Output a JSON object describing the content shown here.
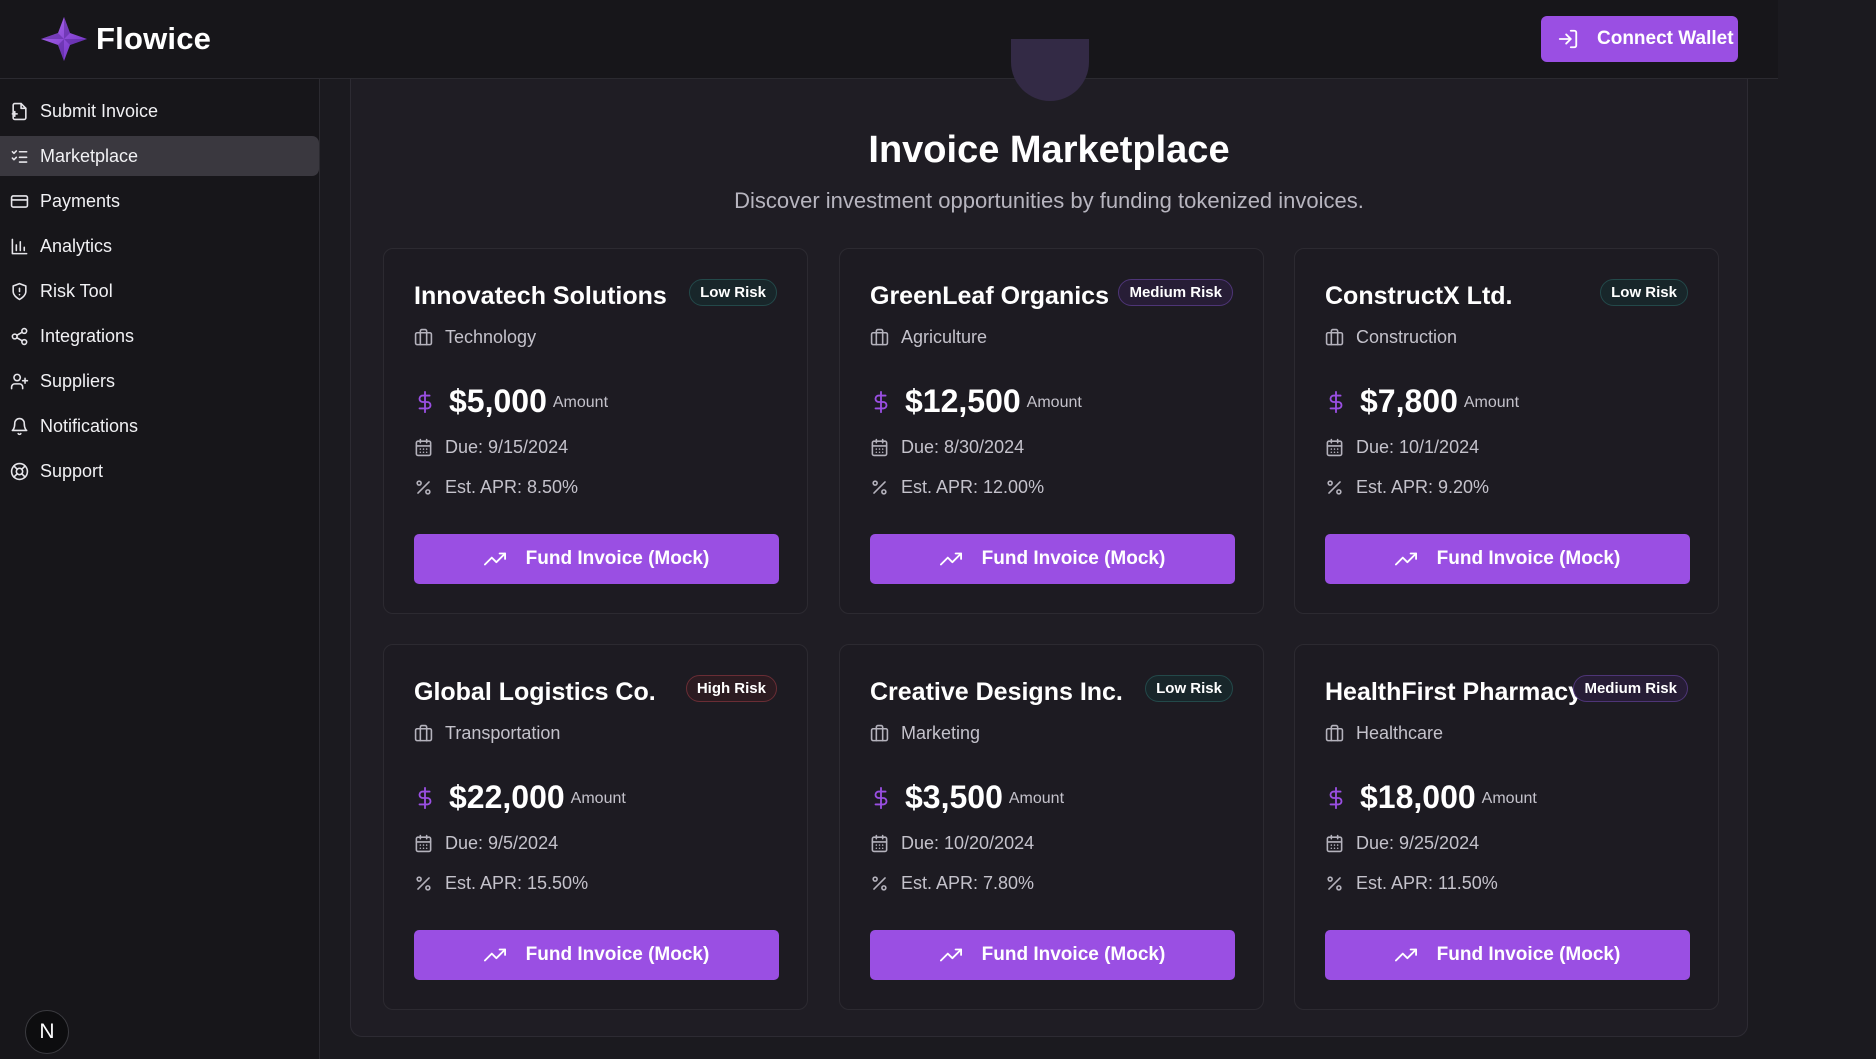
{
  "header": {
    "brand": "Flowice",
    "connect_label": "Connect Wallet"
  },
  "sidebar": {
    "items": [
      {
        "label": "Submit Invoice",
        "icon": "file-upload-icon"
      },
      {
        "label": "Marketplace",
        "icon": "list-check-icon",
        "active": true
      },
      {
        "label": "Payments",
        "icon": "credit-card-icon"
      },
      {
        "label": "Analytics",
        "icon": "bar-chart-icon"
      },
      {
        "label": "Risk Tool",
        "icon": "shield-icon"
      },
      {
        "label": "Integrations",
        "icon": "share-icon"
      },
      {
        "label": "Suppliers",
        "icon": "user-plus-icon"
      },
      {
        "label": "Notifications",
        "icon": "bell-icon"
      },
      {
        "label": "Support",
        "icon": "life-buoy-icon"
      }
    ]
  },
  "dev_badge": "N",
  "main": {
    "title": "Invoice Marketplace",
    "subtitle": "Discover investment opportunities by funding tokenized invoices.",
    "amount_label": "Amount",
    "fund_label": "Fund Invoice (Mock)",
    "cards": [
      {
        "name": "Innovatech Solutions",
        "risk": "Low Risk",
        "risk_level": "low",
        "industry": "Technology",
        "amount": "$5,000",
        "due": "Due: 9/15/2024",
        "apr": "Est. APR: 8.50%"
      },
      {
        "name": "GreenLeaf Organics",
        "risk": "Medium Risk",
        "risk_level": "medium",
        "industry": "Agriculture",
        "amount": "$12,500",
        "due": "Due: 8/30/2024",
        "apr": "Est. APR: 12.00%"
      },
      {
        "name": "ConstructX Ltd.",
        "risk": "Low Risk",
        "risk_level": "low",
        "industry": "Construction",
        "amount": "$7,800",
        "due": "Due: 10/1/2024",
        "apr": "Est. APR: 9.20%"
      },
      {
        "name": "Global Logistics Co.",
        "risk": "High Risk",
        "risk_level": "high",
        "industry": "Transportation",
        "amount": "$22,000",
        "due": "Due: 9/5/2024",
        "apr": "Est. APR: 15.50%"
      },
      {
        "name": "Creative Designs Inc.",
        "risk": "Low Risk",
        "risk_level": "low",
        "industry": "Marketing",
        "amount": "$3,500",
        "due": "Due: 10/20/2024",
        "apr": "Est. APR: 7.80%"
      },
      {
        "name": "HealthFirst Pharmacy",
        "risk": "Medium Risk",
        "risk_level": "medium",
        "industry": "Healthcare",
        "amount": "$18,000",
        "due": "Due: 9/25/2024",
        "apr": "Est. APR: 11.50%"
      }
    ]
  },
  "colors": {
    "accent": "#9a4fe3",
    "background": "#1b1a1f",
    "panel": "#1f1d24"
  }
}
